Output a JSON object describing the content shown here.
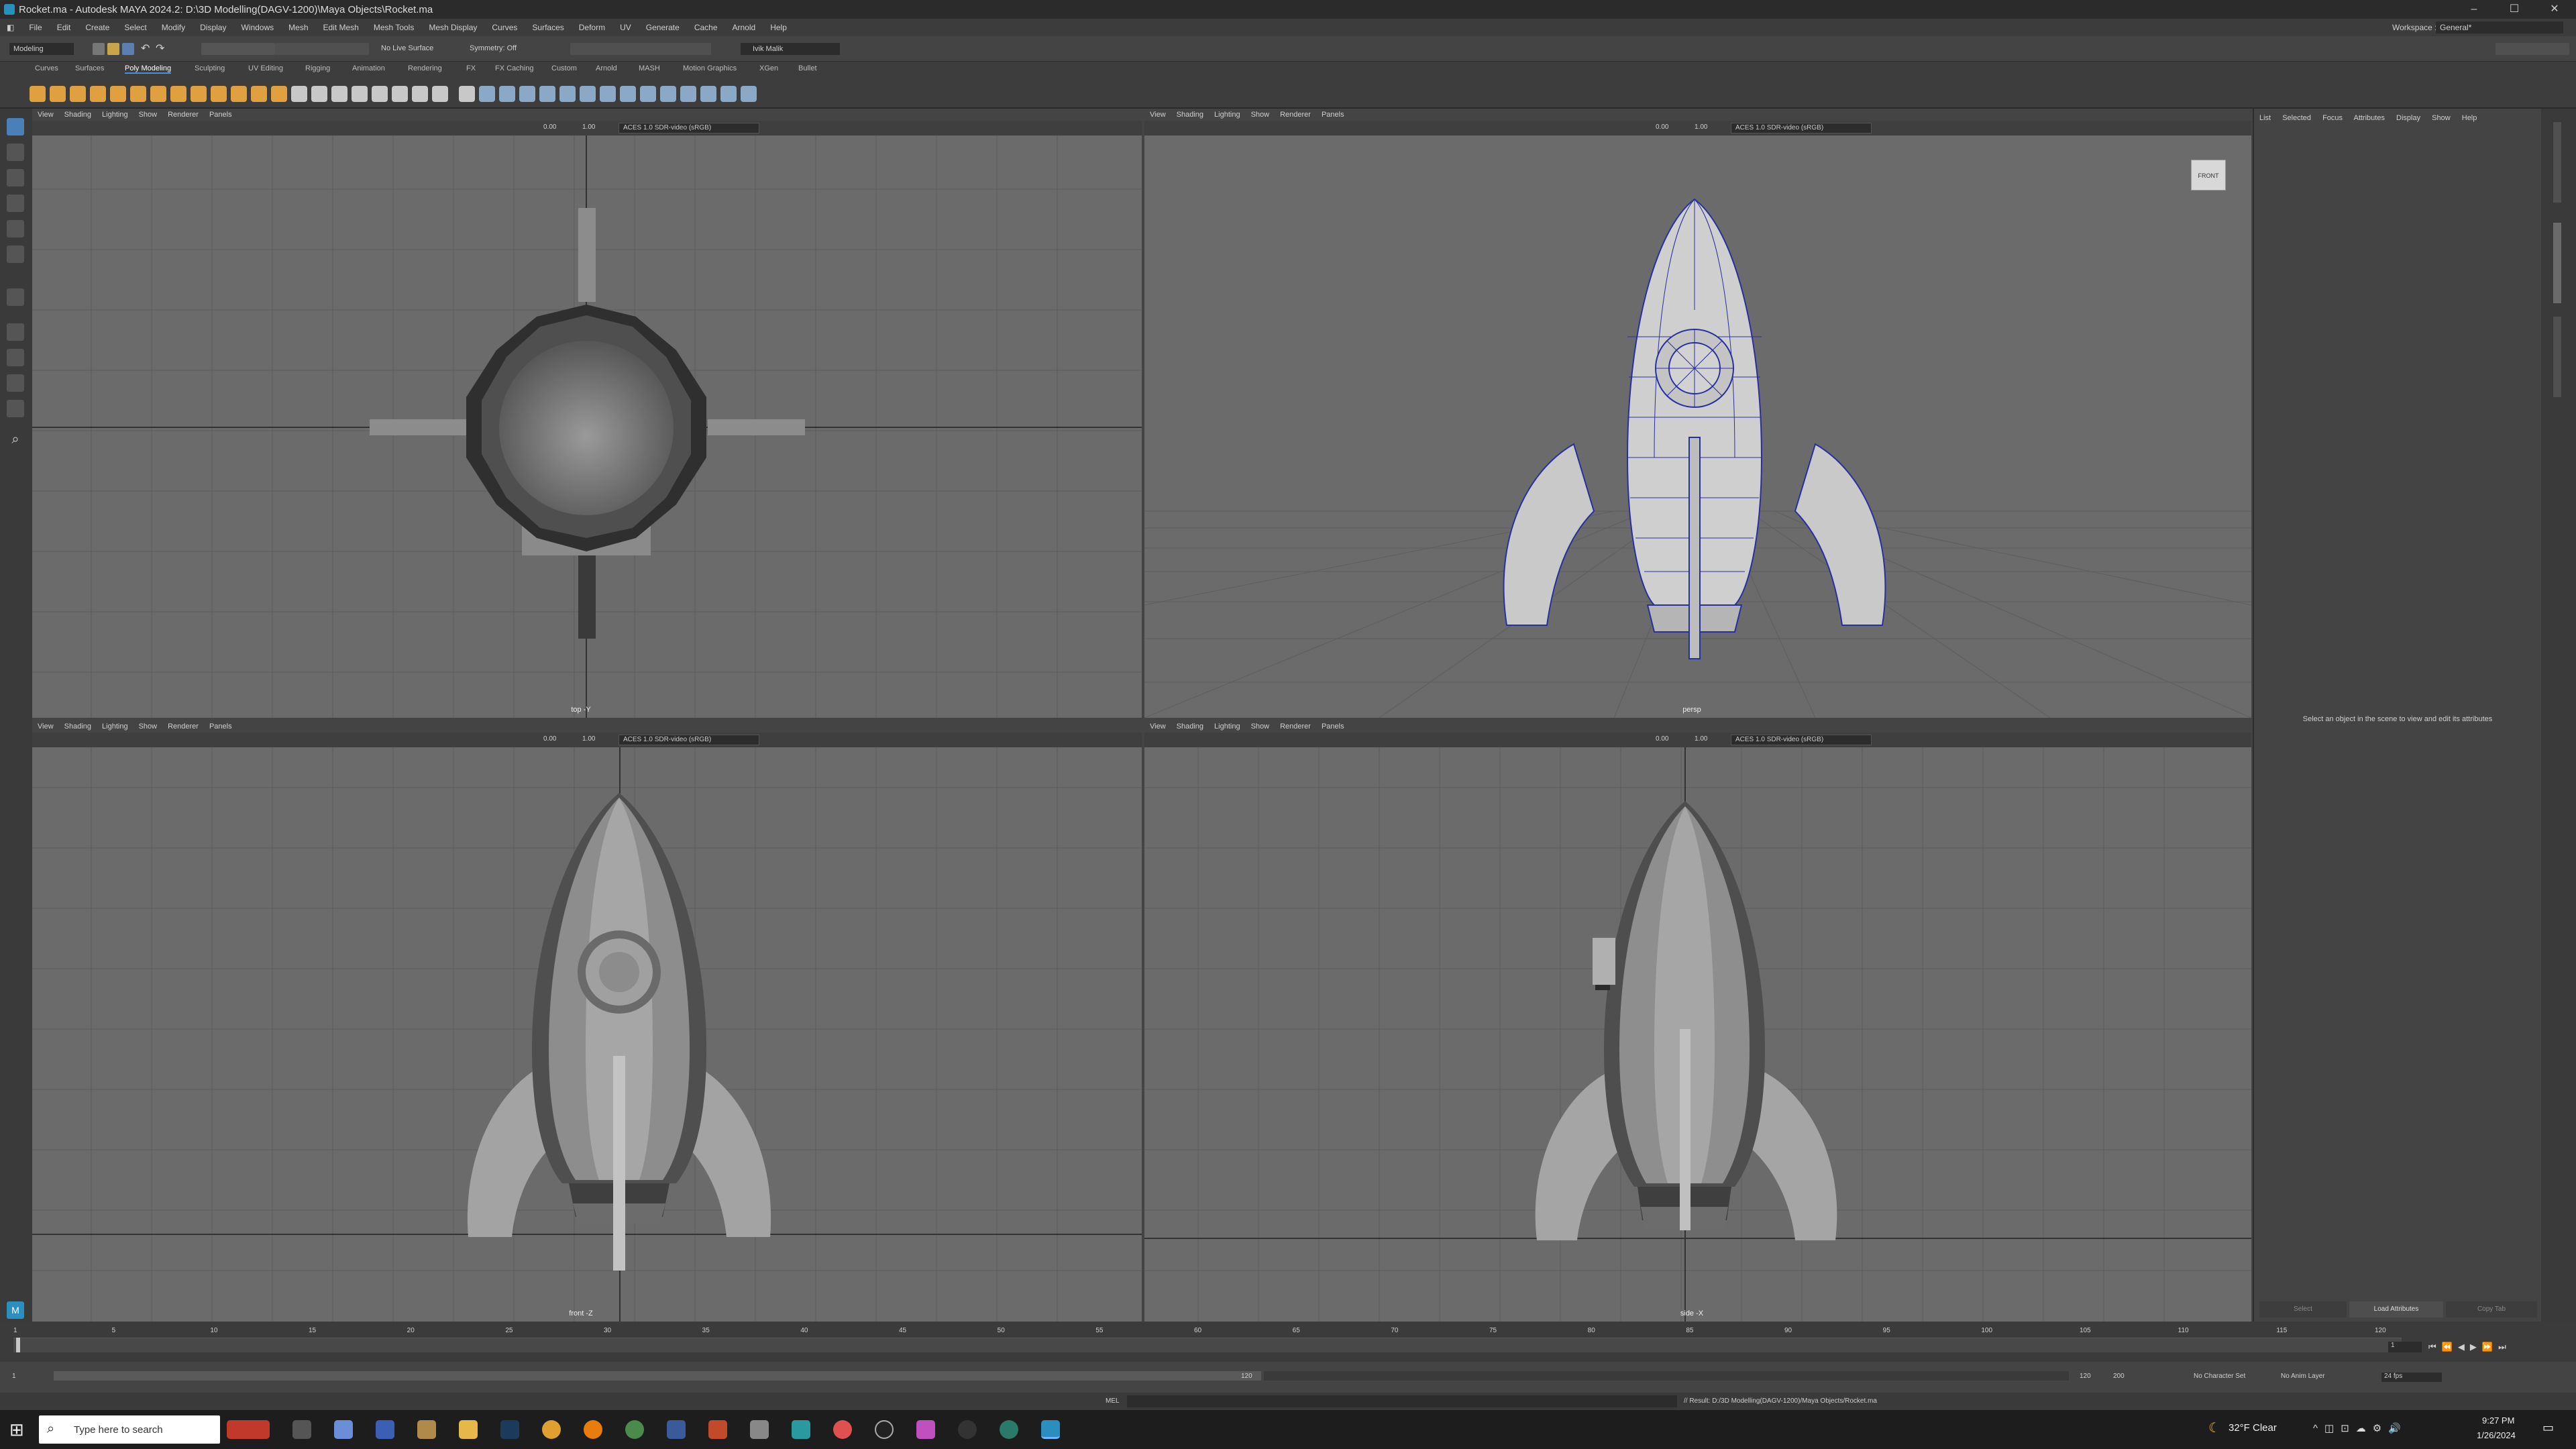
{
  "window": {
    "title": "Rocket.ma - Autodesk MAYA 2024.2: D:\\3D Modelling(DAGV-1200)\\Maya Objects\\Rocket.ma",
    "controls": [
      "–",
      "☐",
      "✕"
    ]
  },
  "menu": [
    "File",
    "Edit",
    "Create",
    "Select",
    "Modify",
    "Display",
    "Windows",
    "Mesh",
    "Edit Mesh",
    "Mesh Tools",
    "Mesh Display",
    "Curves",
    "Surfaces",
    "Deform",
    "UV",
    "Generate",
    "Cache",
    "Arnold",
    "Help"
  ],
  "workspace": {
    "label": "Workspace :",
    "value": "General*"
  },
  "status": {
    "mode": "Modeling",
    "live_surface": "No Live Surface",
    "symmetry": "Symmetry: Off",
    "user": "Ivik Malik"
  },
  "shelf_tabs": [
    "Curves",
    "Surfaces",
    "Poly Modeling",
    "Sculpting",
    "UV Editing",
    "Rigging",
    "Animation",
    "Rendering",
    "FX",
    "FX Caching",
    "Custom",
    "Arnold",
    "MASH",
    "Motion Graphics",
    "XGen",
    "Bullet"
  ],
  "shelf_active": "Poly Modeling",
  "viewport_menu": [
    "View",
    "Shading",
    "Lighting",
    "Show",
    "Renderer",
    "Panels"
  ],
  "viewport_fields": {
    "near": "0.00",
    "far": "1.00",
    "colorspace": "ACES 1.0 SDR-video (sRGB)"
  },
  "viewports": {
    "top": "top -Y",
    "persp": "persp",
    "front": "front -Z",
    "side": "side -X",
    "viewcube": "FRONT"
  },
  "attr_editor": {
    "menu": [
      "List",
      "Selected",
      "Focus",
      "Attributes",
      "Display",
      "Show",
      "Help"
    ],
    "hint": "Select an object in the scene to view and edit its attributes",
    "buttons": [
      "Select",
      "Load Attributes",
      "Copy Tab"
    ]
  },
  "timeline": {
    "ticks": [
      "1",
      "5",
      "10",
      "15",
      "20",
      "25",
      "30",
      "35",
      "40",
      "45",
      "50",
      "55",
      "60",
      "65",
      "70",
      "75",
      "80",
      "85",
      "90",
      "95",
      "100",
      "105",
      "110",
      "115",
      "120"
    ],
    "current": "1"
  },
  "range": {
    "start": "1",
    "start2": "1",
    "end": "120",
    "end2": "120",
    "max": "200",
    "char_set": "No Character Set",
    "anim_layer": "No Anim Layer",
    "fps": "24 fps"
  },
  "cmdline": {
    "lang": "MEL",
    "result": "// Result: D:/3D Modelling(DAGV-1200)/Maya Objects/Rocket.ma"
  },
  "taskbar": {
    "search": "Type here to search",
    "weather": "32°F  Clear",
    "time": "9:27 PM",
    "date": "1/26/2024"
  },
  "colors": {
    "viewport": "#6b6b6b",
    "grid": "#5b5b5b",
    "wire": "#2a2fa0",
    "accent": "#4a90d9",
    "shelf_icon": "#e0a040"
  }
}
